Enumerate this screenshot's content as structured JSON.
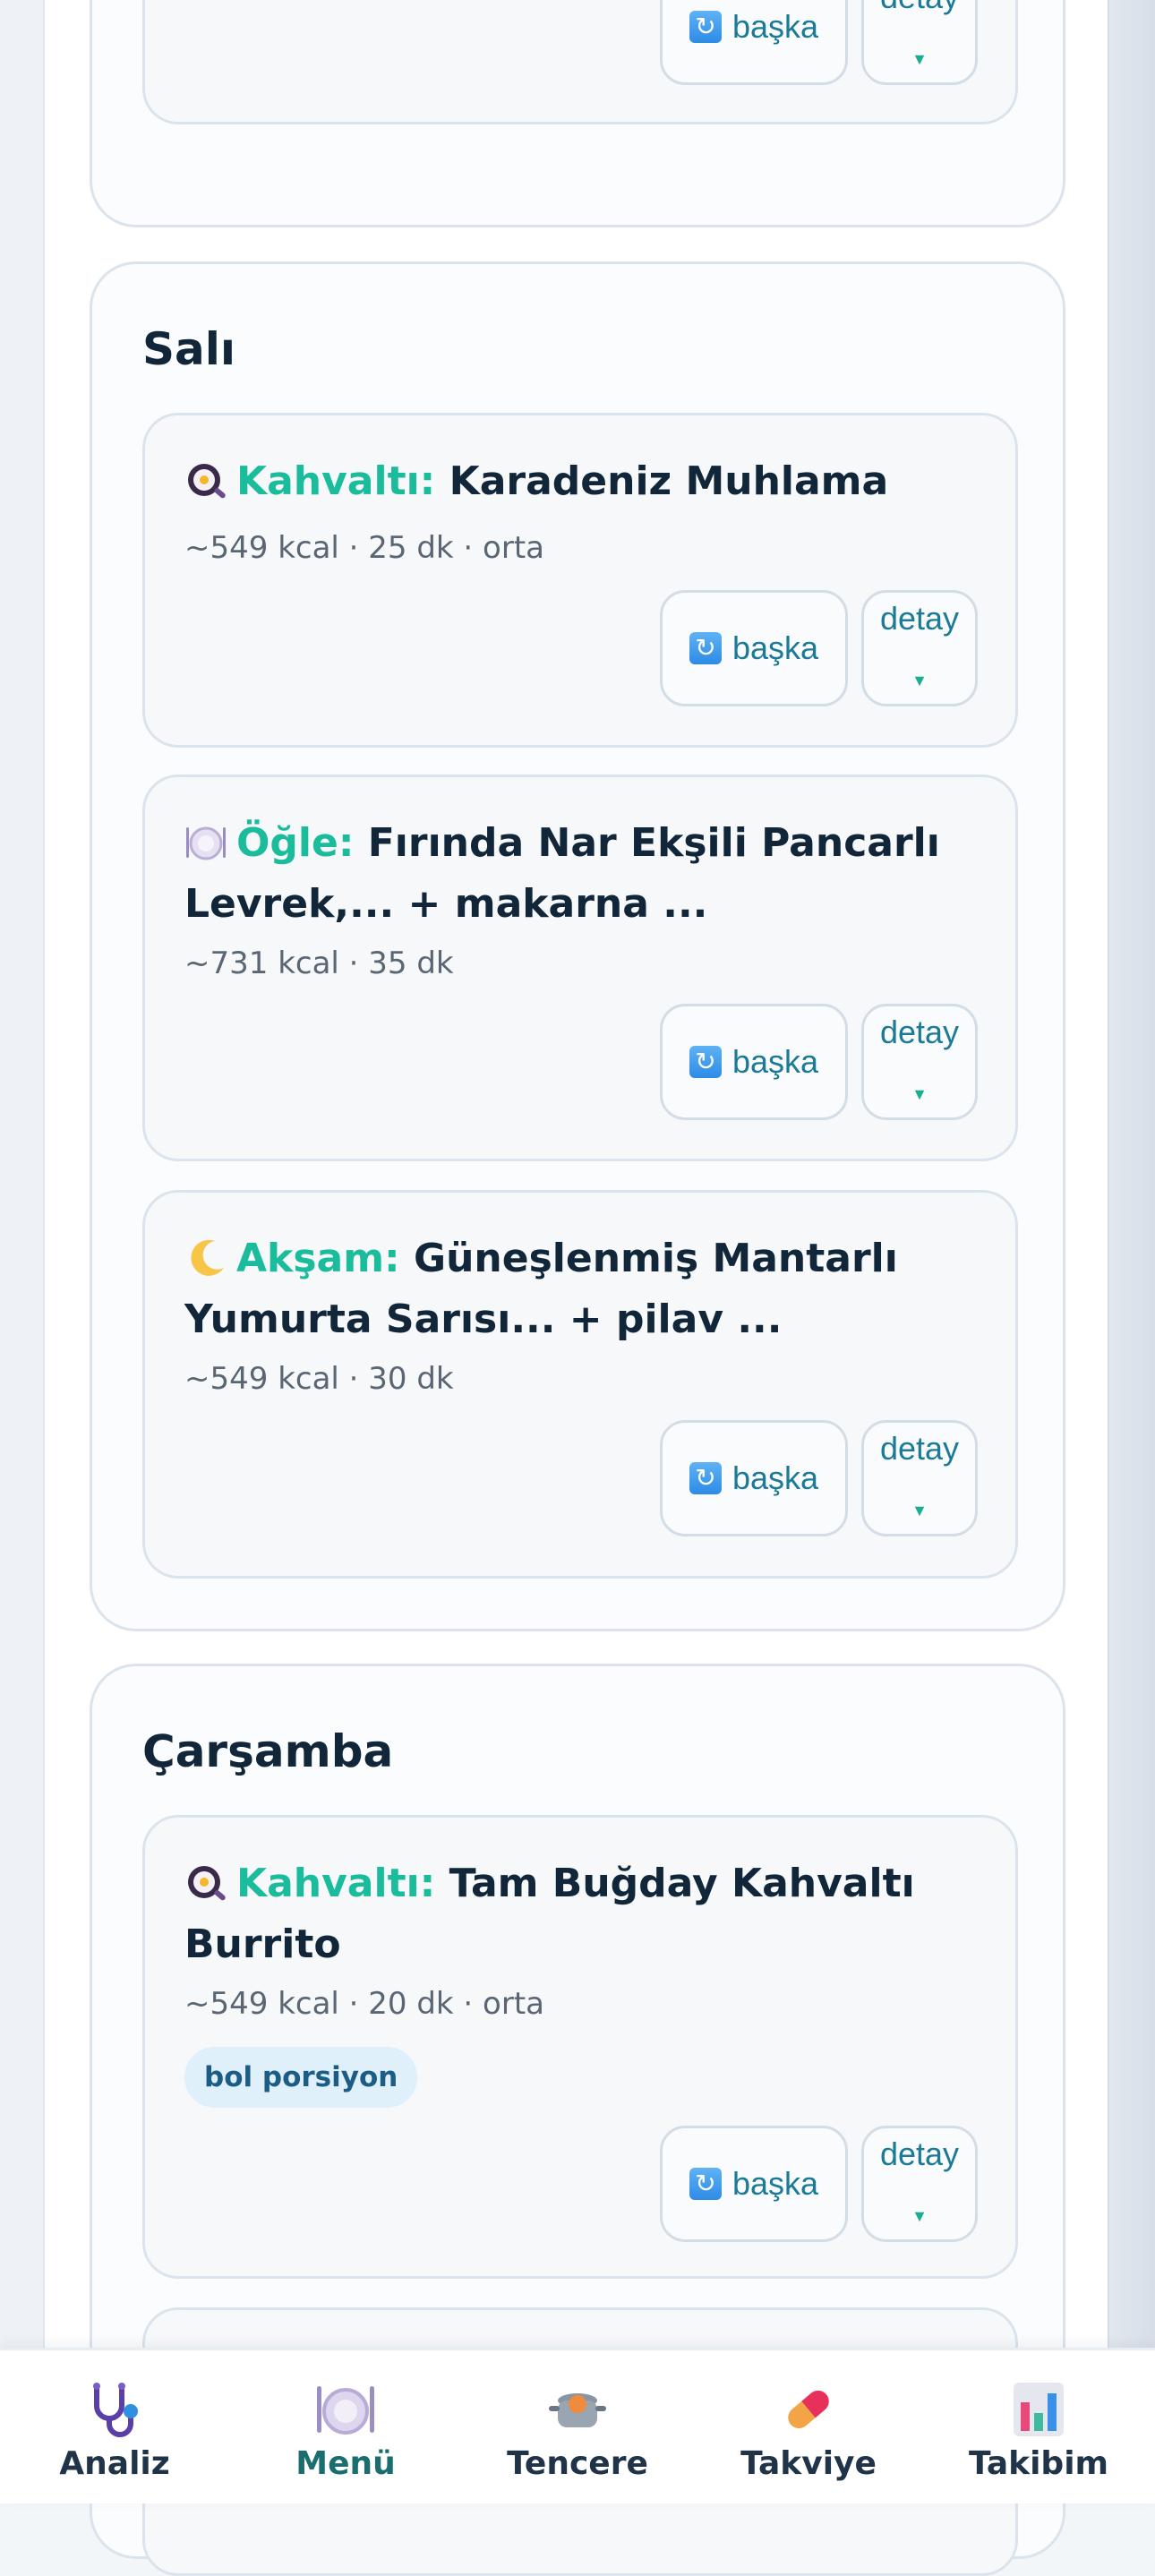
{
  "colors": {
    "accent": "#1abc9c",
    "text": "#12263a",
    "meta": "#5a6673",
    "link": "#1b7a97",
    "tag_bg": "#dff0fb"
  },
  "buttons": {
    "other_label": "başka",
    "detail_label": "detay",
    "other_icon": "refresh-icon",
    "detail_icon": "caret-down-icon"
  },
  "days": [
    {
      "title": "Salı",
      "meals": [
        {
          "icon": "frying-pan-icon",
          "label": "Kahvaltı:",
          "name": "Karadeniz Muhlama",
          "meta": "~549 kcal · 25 dk · orta"
        },
        {
          "icon": "plate-icon",
          "label": "Öğle:",
          "name": "Fırında Nar Ekşili Pancarlı Levrek,... + makarna ...",
          "meta": "~731 kcal · 35 dk"
        },
        {
          "icon": "moon-icon",
          "label": "Akşam:",
          "name": "Güneşlenmiş Mantarlı Yumurta Sarısı... + pilav ...",
          "meta": "~549 kcal · 30 dk"
        }
      ]
    },
    {
      "title": "Çarşamba",
      "meals": [
        {
          "icon": "frying-pan-icon",
          "label": "Kahvaltı:",
          "name": "Tam Buğday Kahvaltı Burrito",
          "meta": "~549 kcal · 20 dk · orta",
          "tag": "bol porsiyon"
        }
      ]
    }
  ],
  "tabs": [
    {
      "label": "Analiz",
      "icon": "stethoscope-icon",
      "active": false
    },
    {
      "label": "Menü",
      "icon": "plate-icon",
      "active": true
    },
    {
      "label": "Tencere",
      "icon": "pot-icon",
      "active": false
    },
    {
      "label": "Takviye",
      "icon": "pill-icon",
      "active": false
    },
    {
      "label": "Takibim",
      "icon": "bar-chart-icon",
      "active": false
    }
  ]
}
